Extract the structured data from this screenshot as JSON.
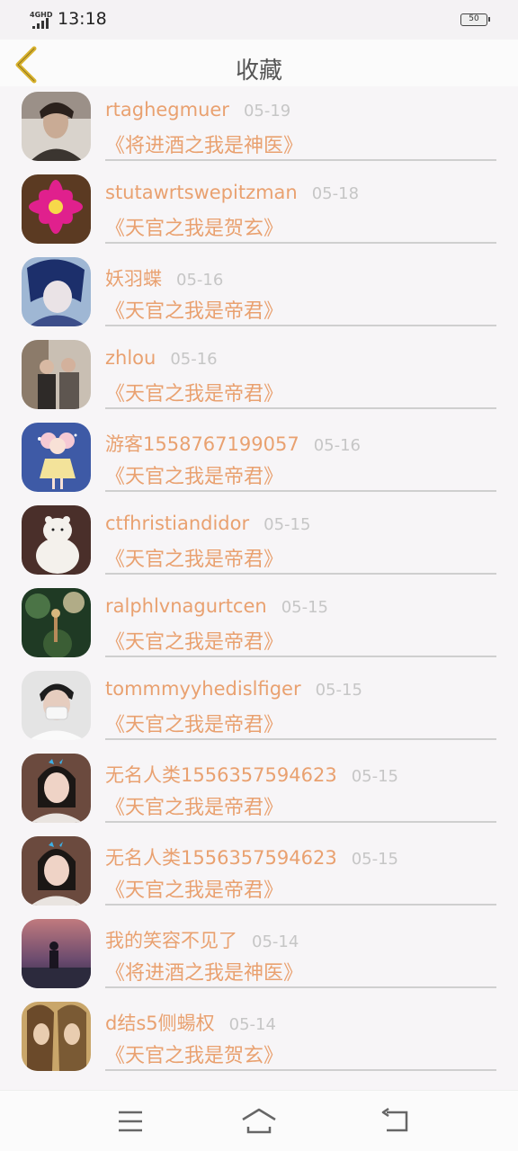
{
  "status": {
    "network": "4GHD",
    "time": "13:18",
    "battery": "50"
  },
  "header": {
    "title": "收藏",
    "back_icon": "chevron-left-icon"
  },
  "colors": {
    "accent": "#e9a170",
    "date": "#c6c6c6",
    "back": "#d9b32e"
  },
  "items": [
    {
      "name": "rtaghegmuer",
      "date": "05-19",
      "book": "《将进酒之我是神医》"
    },
    {
      "name": "stutawrtswepitzman",
      "date": "05-18",
      "book": "《天官之我是贺玄》"
    },
    {
      "name": "妖羽蝶",
      "date": "05-16",
      "book": "《天官之我是帝君》"
    },
    {
      "name": "zhlou",
      "date": "05-16",
      "book": "《天官之我是帝君》"
    },
    {
      "name": "游客1558767199057",
      "date": "05-16",
      "book": "《天官之我是帝君》"
    },
    {
      "name": "ctfhristiandidor",
      "date": "05-15",
      "book": "《天官之我是帝君》"
    },
    {
      "name": "ralphlvnagurtcen",
      "date": "05-15",
      "book": "《天官之我是帝君》"
    },
    {
      "name": "tommmyyhedislfiger",
      "date": "05-15",
      "book": "《天官之我是帝君》"
    },
    {
      "name": "无名人类1556357594623",
      "date": "05-15",
      "book": "《天官之我是帝君》"
    },
    {
      "name": "无名人类1556357594623",
      "date": "05-15",
      "book": "《天官之我是帝君》"
    },
    {
      "name": "我的笑容不见了",
      "date": "05-14",
      "book": "《将进酒之我是神医》"
    },
    {
      "name": "d结s5侧蝪权",
      "date": "05-14",
      "book": "《天官之我是贺玄》"
    }
  ],
  "system_nav": {
    "menu_icon": "menu-icon",
    "home_icon": "home-icon",
    "back_icon": "back-arrow-icon"
  }
}
